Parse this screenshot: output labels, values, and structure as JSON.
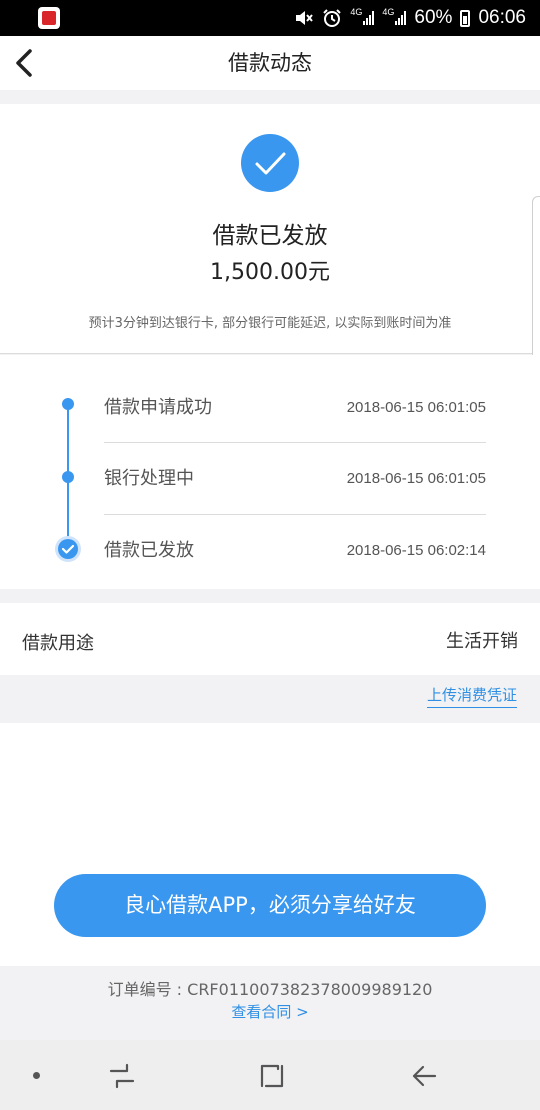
{
  "status_bar": {
    "app_icon": "red-app-icon",
    "icons": [
      "mute-icon",
      "alarm-icon",
      "signal-4g-icon",
      "signal-4g-icon",
      "battery-icon"
    ],
    "net1": "4G",
    "net2": "4G",
    "battery": "60%",
    "time": "06:06"
  },
  "header": {
    "back_icon": "chevron-left-icon",
    "title": "借款动态"
  },
  "summary": {
    "icon": "check-circle-icon",
    "status": "借款已发放",
    "amount": "1,500.00元",
    "hint": "预计3分钟到达银行卡, 部分银行可能延迟, 以实际到账时间为准"
  },
  "timeline": [
    {
      "label": "借款申请成功",
      "time": "2018-06-15 06:01:05"
    },
    {
      "label": "银行处理中",
      "time": "2018-06-15 06:01:05"
    },
    {
      "label": "借款已发放",
      "time": "2018-06-15 06:02:14"
    }
  ],
  "purpose": {
    "label": "借款用途",
    "value": "生活开销"
  },
  "upload_link": "上传消费凭证",
  "share_button": "良心借款APP，必须分享给好友",
  "footer": {
    "order_no": "订单编号 : CRF0110073823780099891​20",
    "contract_link": "查看合同 >"
  },
  "colors": {
    "accent": "#3a97ef",
    "link": "#2f8fe4"
  }
}
